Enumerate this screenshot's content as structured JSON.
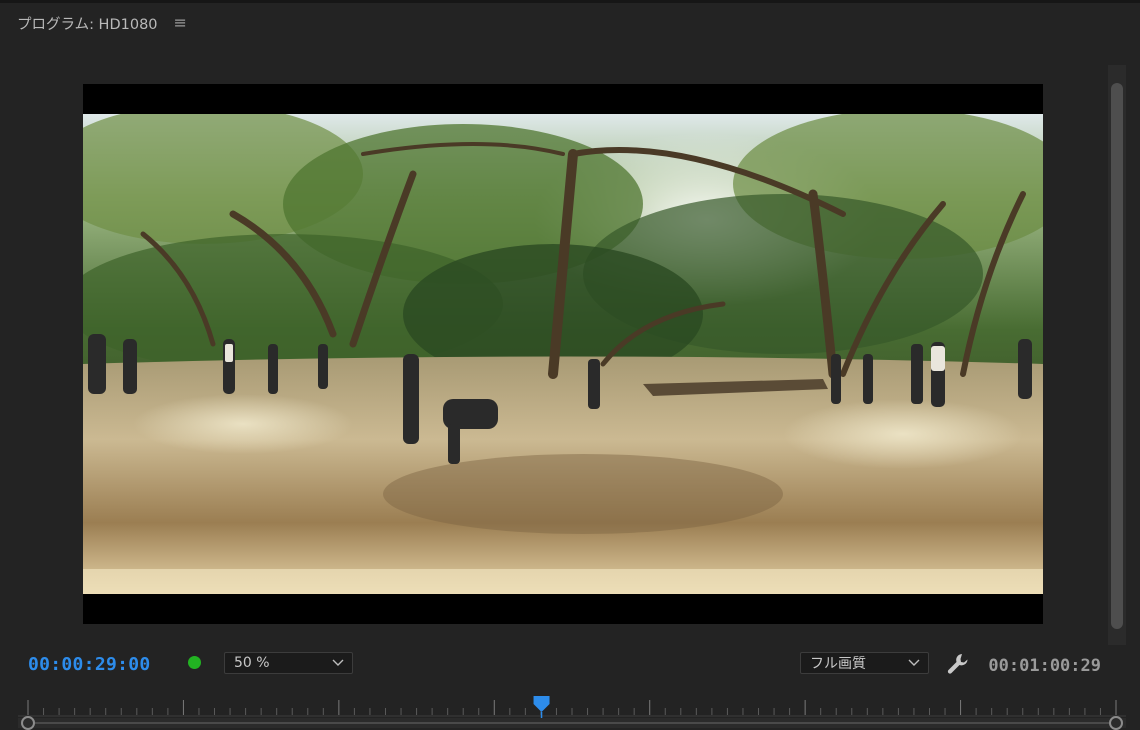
{
  "panel": {
    "title": "プログラム: HD1080",
    "menu_icon": "hamburger-menu-icon"
  },
  "playback": {
    "current_timecode": "00:00:29:00",
    "duration_timecode": "00:01:00:29",
    "status_color": "#22b322"
  },
  "zoom": {
    "selected": "50 %"
  },
  "quality": {
    "selected": "フル画質"
  },
  "icons": {
    "settings": "wrench-icon",
    "playhead": "playhead-marker-icon",
    "dropdown": "chevron-down-icon"
  },
  "colors": {
    "accent": "#2d8ceb",
    "background": "#232323",
    "status_green": "#22b322"
  },
  "timeline": {
    "playhead_position_fraction": 0.472
  }
}
